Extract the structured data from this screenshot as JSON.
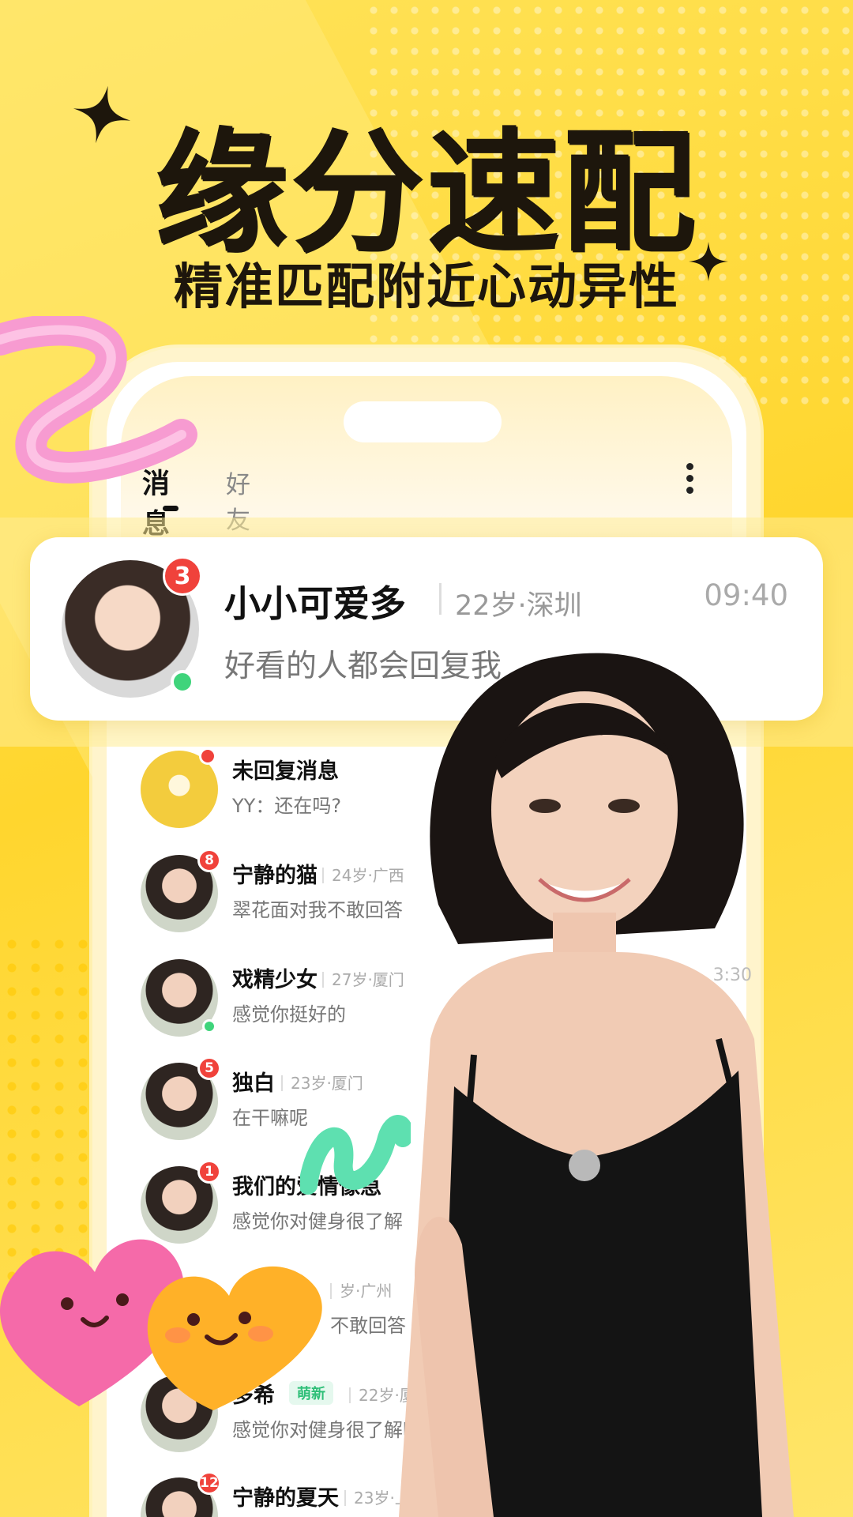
{
  "headline": "缘分速配",
  "subline": "精准匹配附近心动异性",
  "tabs": {
    "active": "消息",
    "inactive": "好友"
  },
  "featured": {
    "name": "小小可爱多",
    "meta": "22岁·深圳",
    "time": "09:40",
    "message": "好看的人都会回复我",
    "badge": "3"
  },
  "list": [
    {
      "name": "未回复消息",
      "meta": "",
      "message": "YY：还在吗?",
      "badge": "",
      "type": "bell"
    },
    {
      "name": "宁静的猫",
      "meta": "24岁·广西",
      "message": "翠花面对我不敢回答",
      "badge": "8"
    },
    {
      "name": "戏精少女",
      "meta": "27岁·厦门",
      "message": "感觉你挺好的",
      "badge": "",
      "online": true,
      "time": "3:30"
    },
    {
      "name": "独白",
      "meta": "23岁·厦门",
      "message": "在干嘛呢",
      "badge": "5"
    },
    {
      "name": "我们的爱情像急",
      "meta": "",
      "message": "感觉你对健身很了解",
      "badge": "1"
    },
    {
      "name": "",
      "meta": "岁·广州",
      "message": "不敢回答",
      "badge": ""
    },
    {
      "name": "多希",
      "tag": "萌新",
      "meta": "22岁·厦门",
      "message": "感觉你对健身很了解呀,",
      "badge": ""
    },
    {
      "name": "宁静的夏天",
      "meta": "23岁·上海",
      "message": "",
      "badge": "12"
    }
  ],
  "colors": {
    "background": "#ffd93a",
    "accent_red": "#f0423b",
    "online_green": "#3fd47b",
    "text_dark": "#1d160c"
  }
}
